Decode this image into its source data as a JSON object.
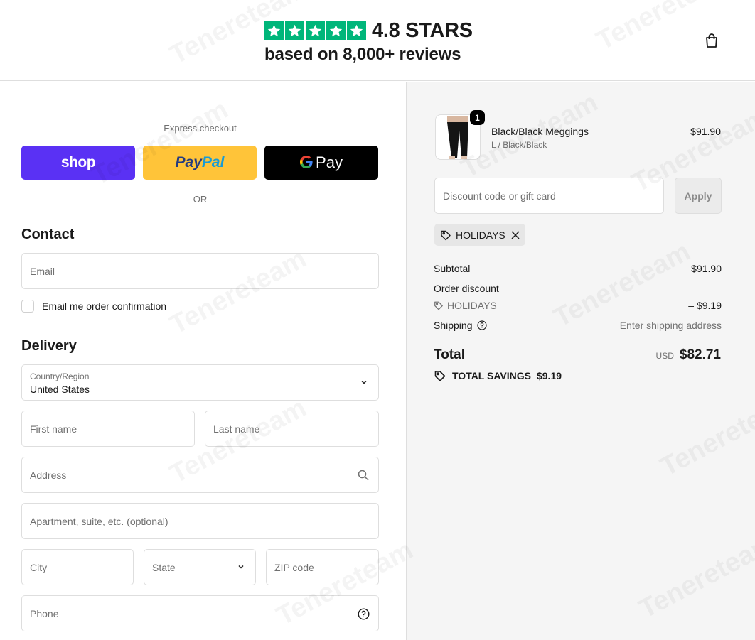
{
  "header": {
    "rating_text": "4.8 STARS",
    "reviews_text": "based on 8,000+ reviews",
    "star_count": 5,
    "star_color": "#00b67a",
    "cart_icon": "shopping-bag-icon"
  },
  "express": {
    "label": "Express checkout",
    "shop_label": "shop",
    "paypal_part1": "Pay",
    "paypal_part2": "Pal",
    "gpay_g": "G",
    "gpay_label": "Pay",
    "or_text": "OR"
  },
  "contact": {
    "title": "Contact",
    "email_placeholder": "Email",
    "email_confirmation_label": "Email me order confirmation"
  },
  "delivery": {
    "title": "Delivery",
    "country_label": "Country/Region",
    "country_value": "United States",
    "first_name_placeholder": "First name",
    "last_name_placeholder": "Last name",
    "address_placeholder": "Address",
    "apartment_placeholder": "Apartment, suite, etc. (optional)",
    "city_placeholder": "City",
    "state_placeholder": "State",
    "zip_placeholder": "ZIP code",
    "phone_placeholder": "Phone"
  },
  "summary": {
    "product": {
      "name": "Black/Black Meggings",
      "variant": "L / Black/Black",
      "price": "$91.90",
      "quantity": "1"
    },
    "discount_placeholder": "Discount code or gift card",
    "apply_label": "Apply",
    "applied_code": "HOLIDAYS",
    "subtotal_label": "Subtotal",
    "subtotal_value": "$91.90",
    "order_discount_label": "Order discount",
    "discount_code": "HOLIDAYS",
    "discount_value": "– $9.19",
    "shipping_label": "Shipping",
    "shipping_value": "Enter shipping address",
    "total_label": "Total",
    "currency": "USD",
    "total_value": "$82.71",
    "savings_label": "TOTAL SAVINGS",
    "savings_value": "$9.19"
  },
  "watermark": "Tenereteam",
  "colors": {
    "shop_pay": "#5a31f4",
    "paypal": "#ffc439",
    "gpay": "#000000"
  }
}
